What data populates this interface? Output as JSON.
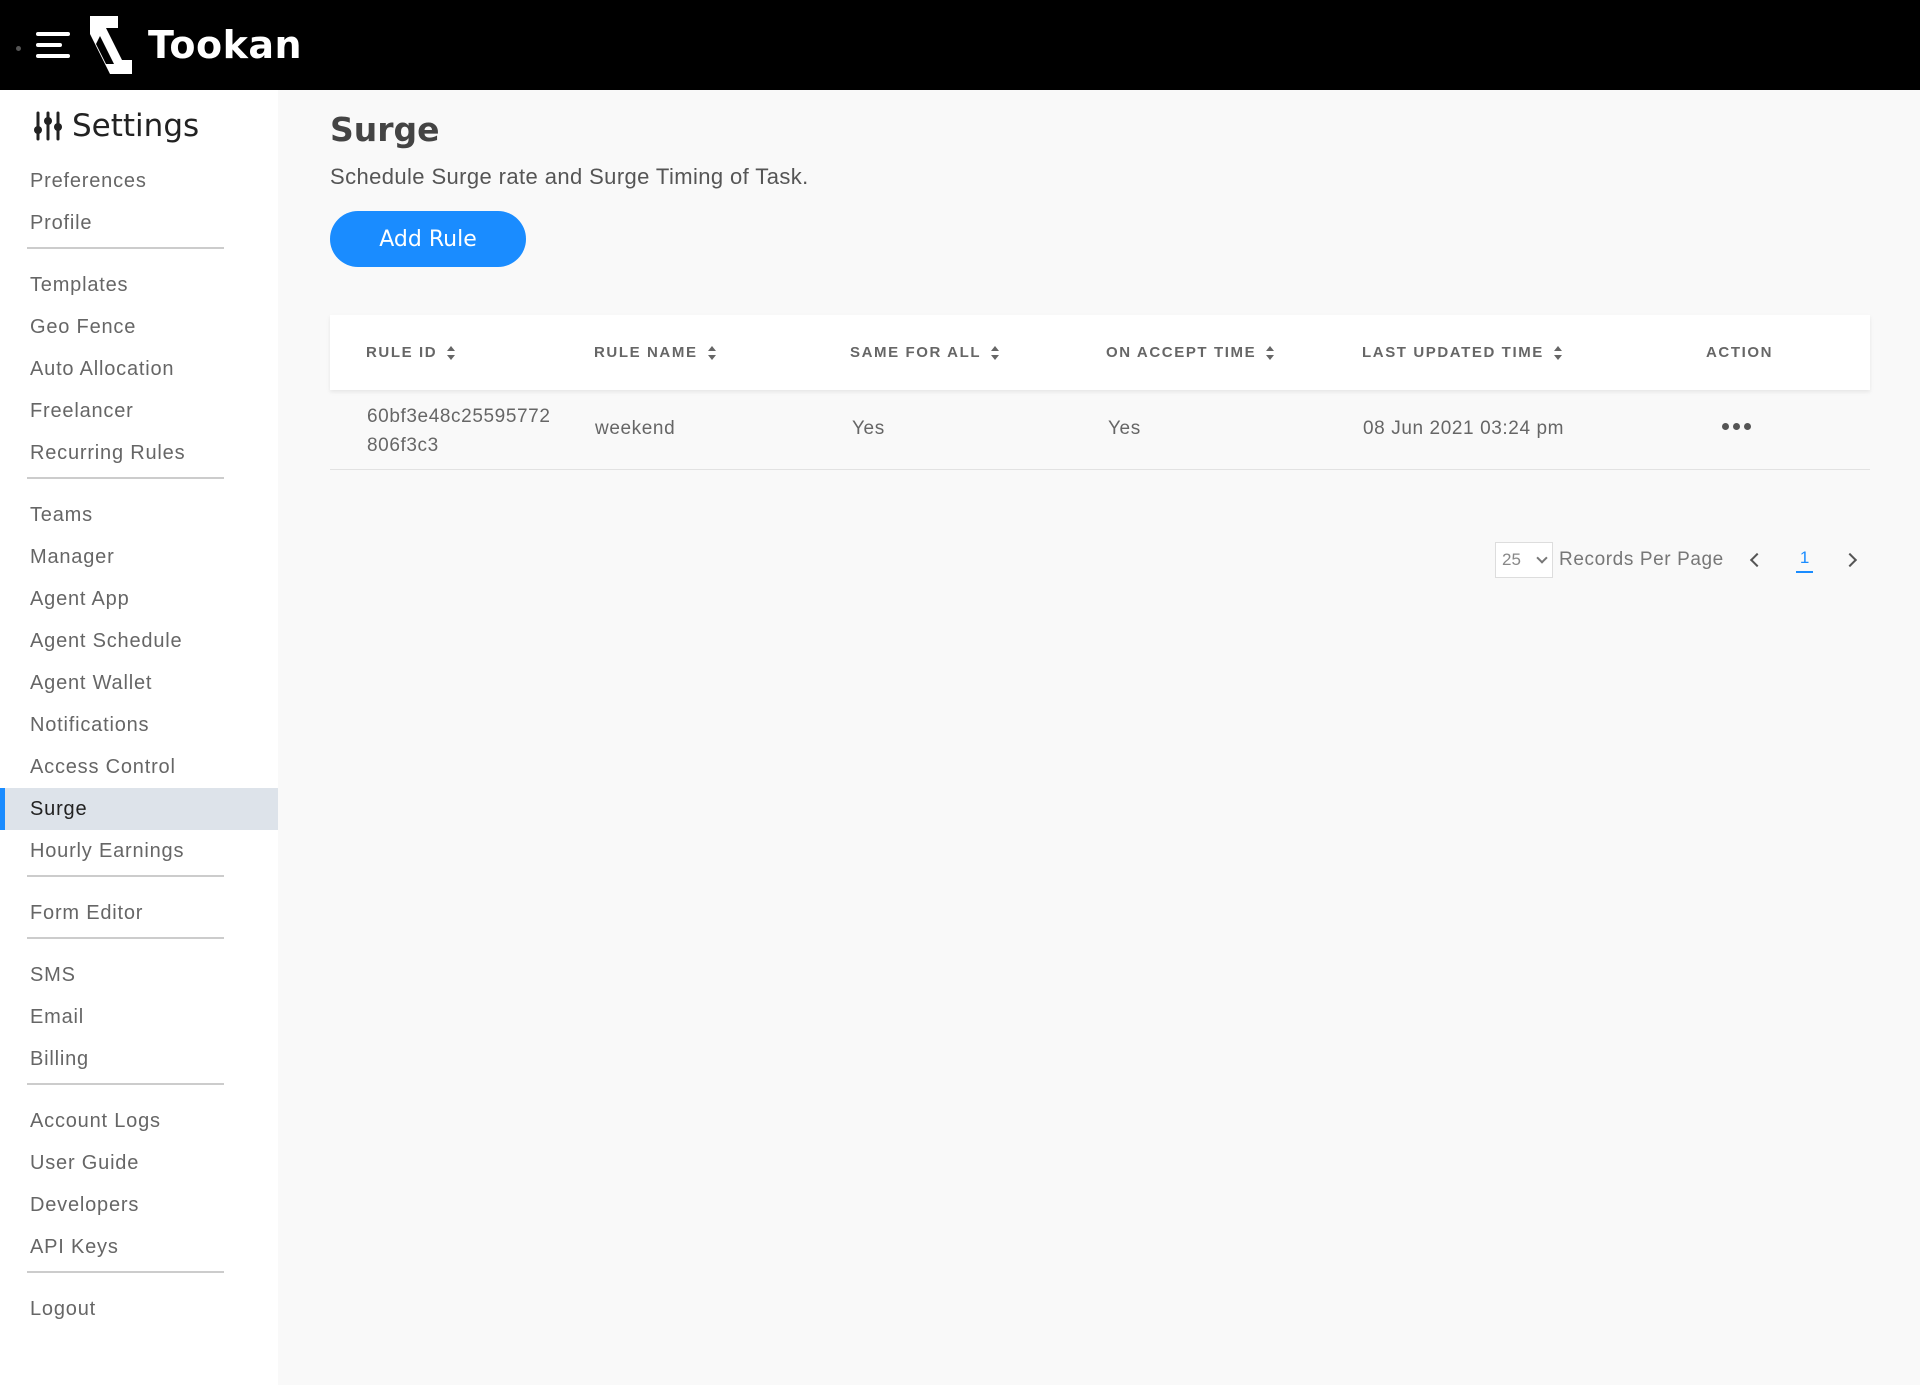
{
  "header": {
    "brand": "Tookan",
    "colors": {
      "bar": "#000000",
      "accent": "#1a8cff"
    }
  },
  "sidebar": {
    "title": "Settings",
    "groups": [
      [
        "Preferences",
        "Profile"
      ],
      [
        "Templates",
        "Geo Fence",
        "Auto Allocation",
        "Freelancer",
        "Recurring Rules"
      ],
      [
        "Teams",
        "Manager",
        "Agent App",
        "Agent Schedule",
        "Agent Wallet",
        "Notifications",
        "Access Control",
        "Surge",
        "Hourly Earnings"
      ],
      [
        "Form Editor"
      ],
      [
        "SMS",
        "Email",
        "Billing"
      ],
      [
        "Account Logs",
        "User Guide",
        "Developers",
        "API Keys"
      ],
      [
        "Logout"
      ]
    ],
    "active": "Surge"
  },
  "page": {
    "title": "Surge",
    "description": "Schedule Surge rate and Surge Timing of Task.",
    "add_button": "Add Rule"
  },
  "table": {
    "columns": [
      "RULE ID",
      "RULE NAME",
      "SAME FOR ALL",
      "ON ACCEPT TIME",
      "LAST UPDATED TIME",
      "ACTION"
    ],
    "rows": [
      {
        "rule_id_line1": "60bf3e48c25595772",
        "rule_id_line2": "806f3c3",
        "rule_name": "weekend",
        "same_for_all": "Yes",
        "on_accept_time": "Yes",
        "last_updated": "08 Jun 2021 03:24 pm"
      }
    ]
  },
  "pagination": {
    "per_page": "25",
    "label": "Records Per Page",
    "current_page": "1"
  }
}
